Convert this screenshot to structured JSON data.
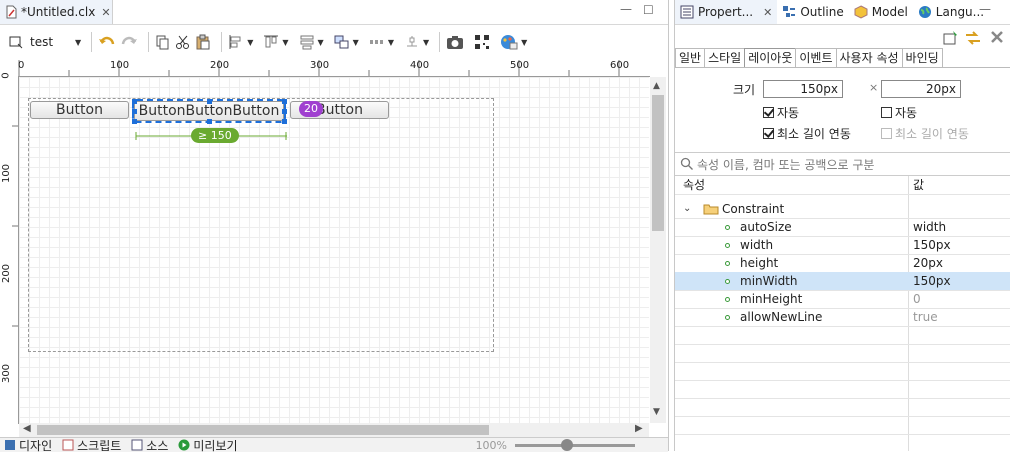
{
  "editor": {
    "tab_title": "*Untitled.clx",
    "toolbar": {
      "target_label": "test"
    },
    "ruler_h": [
      "0",
      "100",
      "200",
      "300",
      "400",
      "500",
      "600"
    ],
    "ruler_v": [
      "0",
      "100",
      "200",
      "300"
    ],
    "canvas": {
      "buttons": [
        {
          "label": "Button"
        },
        {
          "label": "ButtonButtonButton"
        },
        {
          "label": "Button"
        }
      ],
      "height_badge": "20",
      "min_width_badge": "≥ 150"
    },
    "bottom_tabs": [
      "디자인",
      "스크립트",
      "소스",
      "미리보기"
    ],
    "zoom_text": "100%"
  },
  "panel": {
    "view_tabs": [
      "Propert...",
      "Outline",
      "Model",
      "Langu..."
    ],
    "sub_tabs": [
      "일반",
      "스타일",
      "레이아웃",
      "이벤트",
      "사용자 속성",
      "바인딩"
    ],
    "active_sub_tab": "레이아웃",
    "size_label": "크기",
    "width_value": "150px",
    "height_value": "20px",
    "times": "×",
    "auto_label_1": "자동",
    "auto_label_2": "자동",
    "min_link_1": "최소 길이 연동",
    "min_link_2": "최소 길이 연동",
    "search_placeholder": "속성 이름, 컴마 또는 공백으로 구분",
    "col_property": "속성",
    "col_value": "값",
    "group": "Constraint",
    "rows": [
      {
        "key": "autoSize",
        "value": "width",
        "highlight": false,
        "dim": false
      },
      {
        "key": "width",
        "value": "150px",
        "highlight": false,
        "dim": false
      },
      {
        "key": "height",
        "value": "20px",
        "highlight": false,
        "dim": false
      },
      {
        "key": "minWidth",
        "value": "150px",
        "highlight": true,
        "dim": false
      },
      {
        "key": "minHeight",
        "value": "0",
        "highlight": false,
        "dim": true
      },
      {
        "key": "allowNewLine",
        "value": "true",
        "highlight": false,
        "dim": true
      }
    ]
  },
  "colors": {
    "selection": "#1e6fd9",
    "purple_badge": "#a040d0",
    "green_badge": "#6aaa30",
    "row_highlight": "#cfe4f8"
  }
}
